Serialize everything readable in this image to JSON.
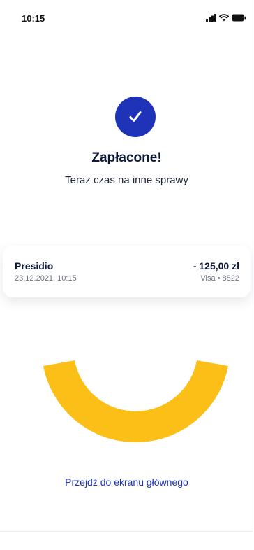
{
  "status_bar": {
    "time": "10:15",
    "icons": [
      "signal-icon",
      "wifi-icon",
      "battery-icon"
    ]
  },
  "confirmation": {
    "icon": "check-icon",
    "title": "Zapłacone!",
    "subtitle": "Teraz czas na inne sprawy"
  },
  "transaction": {
    "merchant": "Presidio",
    "datetime": "23.12.2021, 10:15",
    "amount": "- 125,00 zł",
    "card": "Visa • 8822"
  },
  "decoration": {
    "shape": "smile-arc",
    "color": "#fbbf18"
  },
  "actions": {
    "home_link": "Przejdź do ekranu głównego"
  },
  "colors": {
    "accent": "#1e33b8",
    "highlight": "#fbbf18",
    "text_primary": "#0b1838",
    "text_secondary": "#6b7280"
  }
}
